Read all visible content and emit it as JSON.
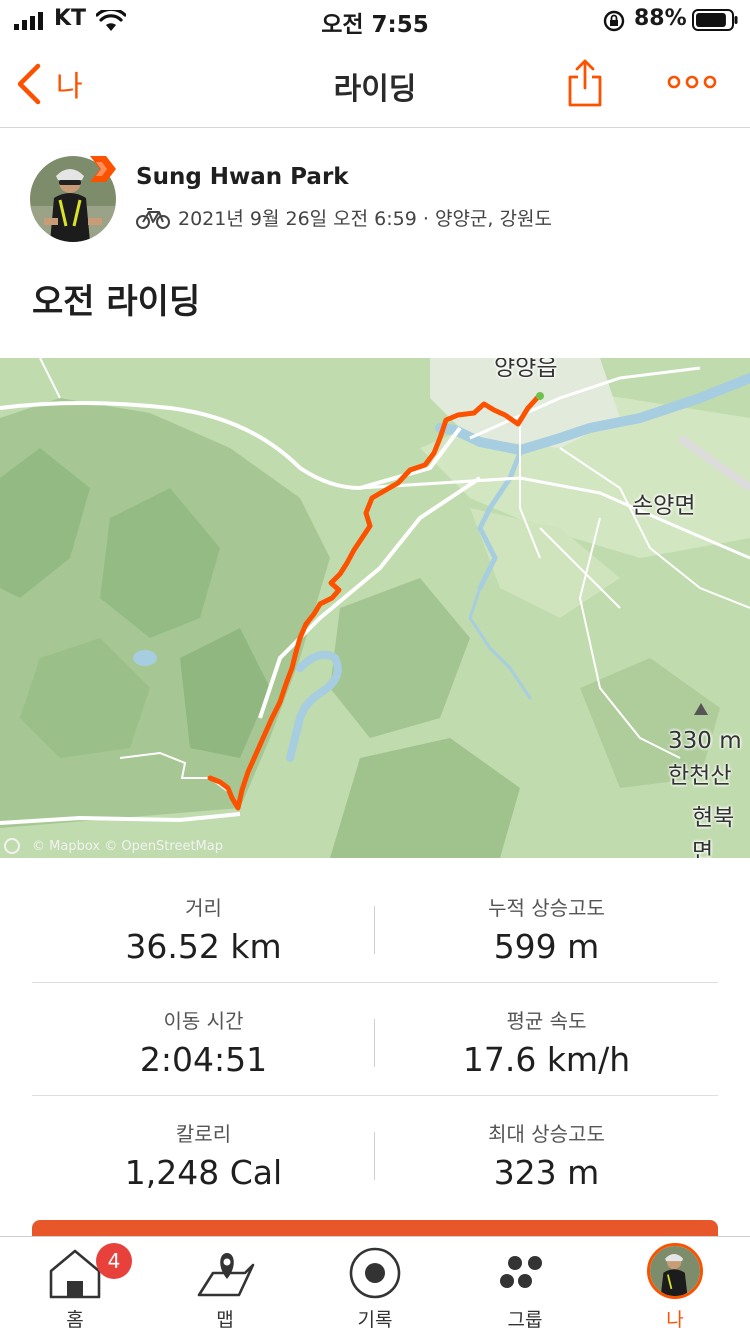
{
  "status_bar": {
    "carrier": "KT",
    "time": "오전 7:55",
    "battery_percent": "88%",
    "battery_level": 0.88
  },
  "nav": {
    "back_label": "나",
    "title": "라이딩"
  },
  "athlete": {
    "name": "Sung Hwan Park",
    "activity_meta": "2021년 9월 26일 오전 6:59 · 양양군, 강원도"
  },
  "activity": {
    "title": "오전 라이딩"
  },
  "map": {
    "labels": {
      "town_top": "양양읍",
      "town_right": "손양면",
      "peak_elevation": "330 m",
      "peak_name": "한천산",
      "town_bottom": "현북면"
    },
    "attribution": "© Mapbox © OpenStreetMap",
    "route_color": "#fc5200"
  },
  "stats": {
    "rows": [
      [
        {
          "label": "거리",
          "value": "36.52 km"
        },
        {
          "label": "누적 상승고도",
          "value": "599 m"
        }
      ],
      [
        {
          "label": "이동 시간",
          "value": "2:04:51"
        },
        {
          "label": "평균 속도",
          "value": "17.6 km/h"
        }
      ],
      [
        {
          "label": "칼로리",
          "value": "1,248 Cal"
        },
        {
          "label": "최대 상승고도",
          "value": "323 m"
        }
      ]
    ]
  },
  "tab_bar": {
    "tabs": [
      {
        "label": "홈",
        "icon": "home-icon",
        "badge": "4"
      },
      {
        "label": "맵",
        "icon": "map-pin-icon"
      },
      {
        "label": "기록",
        "icon": "record-icon"
      },
      {
        "label": "그룹",
        "icon": "group-icon"
      },
      {
        "label": "나",
        "icon": "profile-avatar",
        "active": true
      }
    ]
  },
  "colors": {
    "accent": "#fc5200",
    "badge": "#e8413c"
  }
}
